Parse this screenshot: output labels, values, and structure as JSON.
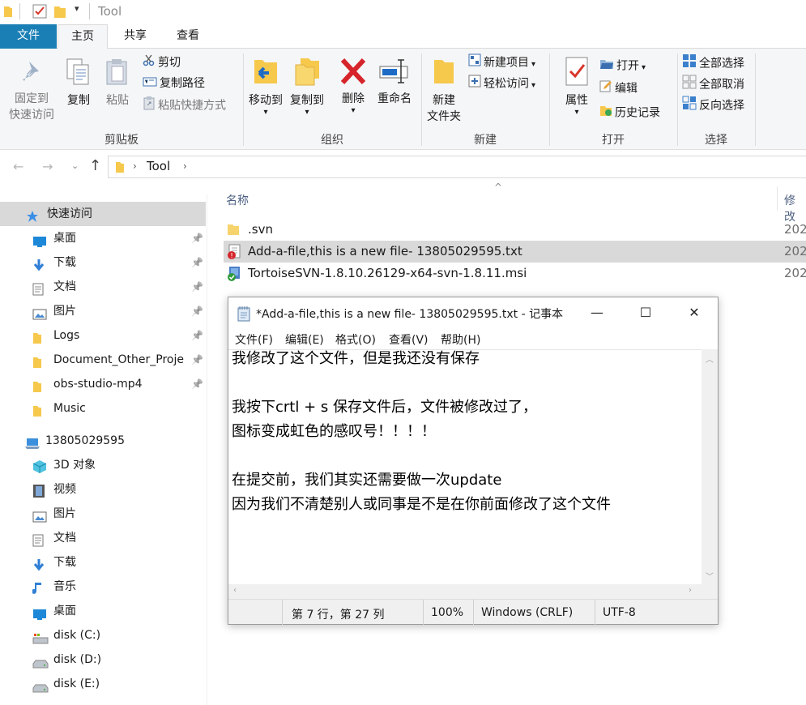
{
  "window": {
    "title": "Tool"
  },
  "tabs": {
    "file": "文件",
    "home": "主页",
    "share": "共享",
    "view": "查看"
  },
  "ribbon": {
    "clipboard": {
      "label": "剪贴板",
      "pin_line1": "固定到",
      "pin_line2": "快速访问",
      "copy": "复制",
      "paste": "粘贴",
      "cut": "剪切",
      "copy_path": "复制路径",
      "paste_shortcut": "粘贴快捷方式"
    },
    "organize": {
      "label": "组织",
      "move_to": "移动到",
      "copy_to": "复制到",
      "delete": "删除",
      "rename": "重命名"
    },
    "new": {
      "label": "新建",
      "new_folder_line1": "新建",
      "new_folder_line2": "文件夹",
      "new_item": "新建项目",
      "easy_access": "轻松访问"
    },
    "open": {
      "label": "打开",
      "properties": "属性",
      "open": "打开",
      "edit": "编辑",
      "history": "历史记录"
    },
    "select": {
      "label": "选择",
      "select_all": "全部选择",
      "select_none": "全部取消",
      "invert": "反向选择"
    }
  },
  "address": {
    "crumb": "Tool"
  },
  "sidebar": {
    "quick_access": "快速访问",
    "quick_items": [
      "桌面",
      "下载",
      "文档",
      "图片",
      "Logs",
      "Document_Other_Proje",
      "obs-studio-mp4",
      "Music"
    ],
    "pc": "13805029595",
    "pc_items": [
      "3D 对象",
      "视频",
      "图片",
      "文档",
      "下载",
      "音乐",
      "桌面",
      "disk (C:)",
      "disk (D:)",
      "disk (E:)"
    ]
  },
  "filelist": {
    "col_name": "名称",
    "col_modified": "修改",
    "files": [
      {
        "name": ".svn",
        "date": "202"
      },
      {
        "name": "Add-a-file,this is a new file- 13805029595.txt",
        "date": "202"
      },
      {
        "name": "TortoiseSVN-1.8.10.26129-x64-svn-1.8.11.msi",
        "date": "202"
      }
    ]
  },
  "notepad": {
    "title": "*Add-a-file,this is a new file- 13805029595.txt - 记事本",
    "menu": [
      "文件(F)",
      "编辑(E)",
      "格式(O)",
      "查看(V)",
      "帮助(H)"
    ],
    "lines": [
      "我修改了这个文件，但是我还没有保存",
      "",
      "我按下crtl + s 保存文件后，文件被修改过了，",
      "图标变成虹色的感叹号！！！！",
      "",
      "在提交前，我们其实还需要做一次update",
      "因为我们不清楚别人或同事是不是在你前面修改了这个文件"
    ],
    "status": {
      "position": "第 7 行，第 27 列",
      "zoom": "100%",
      "eol": "Windows (CRLF)",
      "encoding": "UTF-8"
    }
  }
}
